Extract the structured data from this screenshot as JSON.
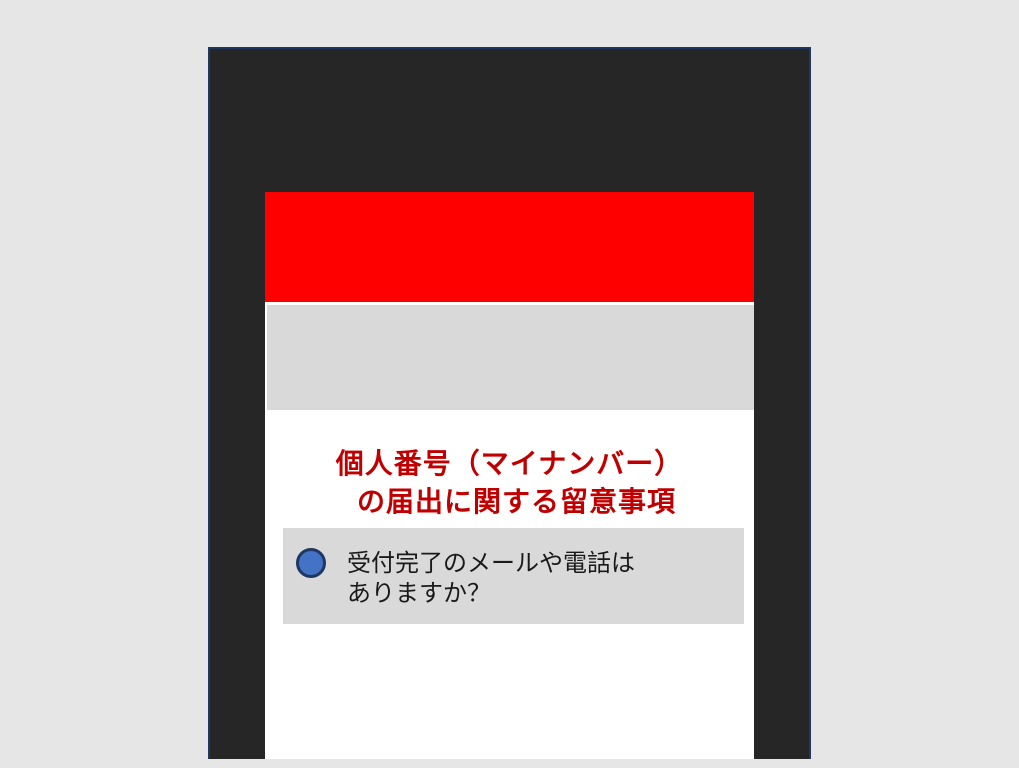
{
  "header": {
    "color": "#ff0000"
  },
  "notice": {
    "title_line1": "個人番号（マイナンバー）",
    "title_line2": "の届出に関する留意事項",
    "title_color": "#c00000"
  },
  "faq": {
    "items": [
      {
        "line1": "受付完了のメールや電話は",
        "line2": "ありますか？",
        "bullet_icon": "circle-bullet-icon",
        "bullet_color": "#4472c4"
      }
    ]
  }
}
